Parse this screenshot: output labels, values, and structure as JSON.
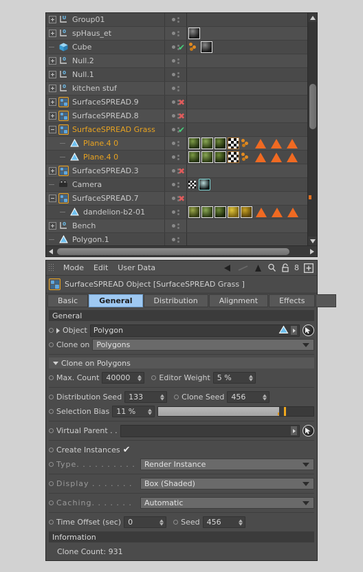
{
  "object_manager": {
    "rows": [
      {
        "name": "Group01",
        "icon": "null-u-icon",
        "indent": 0,
        "expander": "plus",
        "selected": false,
        "mark": "",
        "tags": []
      },
      {
        "name": "spHaus_et",
        "icon": "null-0-icon",
        "indent": 0,
        "expander": "plus",
        "selected": false,
        "mark": "",
        "tags": [
          "material-dark"
        ]
      },
      {
        "name": "Cube",
        "icon": "cube-icon",
        "indent": 0,
        "expander": "stub",
        "selected": false,
        "mark": "ok",
        "tags": [
          "scatter-dots",
          "material-dark"
        ]
      },
      {
        "name": "Null.2",
        "icon": "null-0-icon",
        "indent": 0,
        "expander": "plus",
        "selected": false,
        "mark": "",
        "tags": []
      },
      {
        "name": "Null.1",
        "icon": "null-0-icon",
        "indent": 0,
        "expander": "plus",
        "selected": false,
        "mark": "",
        "tags": []
      },
      {
        "name": "kitchen stuf",
        "icon": "null-0-icon",
        "indent": 0,
        "expander": "plus",
        "selected": false,
        "mark": "",
        "tags": []
      },
      {
        "name": "SurfaceSPREAD.9",
        "icon": "surfacespread-icon",
        "indent": 0,
        "expander": "plus",
        "selected": false,
        "mark": "no",
        "tags": []
      },
      {
        "name": "SurfaceSPREAD.8",
        "icon": "surfacespread-icon",
        "indent": 0,
        "expander": "plus",
        "selected": false,
        "mark": "no",
        "tags": []
      },
      {
        "name": "SurfaceSPREAD Grass",
        "icon": "surfacespread-icon",
        "indent": 0,
        "expander": "minus",
        "selected": true,
        "mark": "ok",
        "tags": []
      },
      {
        "name": "Plane.4 0",
        "icon": "polygon-icon",
        "indent": 1,
        "expander": "stub",
        "selected": true,
        "mark": "",
        "tags": [
          "mat-green-1",
          "mat-green-2",
          "mat-green-3",
          "checker",
          "scatter-dots",
          "tri",
          "tri",
          "tri"
        ]
      },
      {
        "name": "Plane.4 0",
        "icon": "polygon-icon",
        "indent": 1,
        "expander": "stub",
        "selected": true,
        "mark": "",
        "tags": [
          "mat-green-1",
          "mat-green-2",
          "mat-green-3",
          "checker",
          "scatter-dots",
          "tri",
          "tri",
          "tri"
        ]
      },
      {
        "name": "SurfaceSPREAD.3",
        "icon": "surfacespread-icon",
        "indent": 0,
        "expander": "plus",
        "selected": false,
        "mark": "no",
        "tags": []
      },
      {
        "name": "Camera",
        "icon": "camera-icon",
        "indent": 0,
        "expander": "stub",
        "selected": false,
        "mark": "",
        "tags": [
          "checker-small",
          "camera-tag"
        ]
      },
      {
        "name": "SurfaceSPREAD.7",
        "icon": "surfacespread-icon",
        "indent": 0,
        "expander": "minus",
        "selected": false,
        "mark": "no",
        "tags": []
      },
      {
        "name": "dandelion-b2-01",
        "icon": "polygon-icon",
        "indent": 1,
        "expander": "stub",
        "selected": false,
        "mark": "",
        "tags": [
          "mat-olive",
          "mat-green-2",
          "mat-green-3",
          "mat-yellow",
          "mat-yellow-2",
          "tri",
          "tri",
          "tri"
        ]
      },
      {
        "name": "Bench",
        "icon": "null-0-icon",
        "indent": 0,
        "expander": "plus",
        "selected": false,
        "mark": "",
        "tags": []
      },
      {
        "name": "Polygon.1",
        "icon": "polygon-icon",
        "indent": 0,
        "expander": "stub",
        "selected": false,
        "mark": "",
        "tags": []
      }
    ]
  },
  "attribute_manager": {
    "menus": [
      "Mode",
      "Edit",
      "User Data"
    ],
    "toolbar_icons": [
      "back-arrow-icon",
      "history-line-icon",
      "up-arrow-icon",
      "search-icon",
      "lock-icon",
      "group-count-icon",
      "add-panel-icon"
    ],
    "group_count_label": "8",
    "object_title": "SurfaceSPREAD Object [SurfaceSPREAD Grass ]",
    "object_icon": "surfacespread-icon",
    "tabs": [
      {
        "label": "Basic",
        "active": false
      },
      {
        "label": "General",
        "active": true
      },
      {
        "label": "Distribution",
        "active": false
      },
      {
        "label": "Alignment",
        "active": false
      },
      {
        "label": "Effects",
        "active": false
      }
    ],
    "general_group_title": "General",
    "object_field": {
      "label": "Object",
      "value": "Polygon",
      "icon": "polygon-icon",
      "picker": "pick-cursor-icon"
    },
    "clone_on": {
      "label": "Clone on",
      "value": "Polygons"
    },
    "clone_on_polygons": {
      "title": "Clone on Polygons",
      "max_count": {
        "label": "Max. Count",
        "value": "40000"
      },
      "editor_weight": {
        "label": "Editor Weight",
        "value": "5 %"
      },
      "distribution_seed": {
        "label": "Distribution Seed",
        "value": "133"
      },
      "clone_seed": {
        "label": "Clone Seed",
        "value": "456"
      },
      "selection_bias": {
        "label": "Selection Bias",
        "value": "11 %",
        "percent": 11
      }
    },
    "virtual_parent": {
      "label": "Virtual Parent . .",
      "value": ""
    },
    "create_instances": {
      "label": "Create Instances",
      "checked": true,
      "check_glyph": "✔"
    },
    "type": {
      "label": "Type. . . . . . . . . .",
      "value": "Render Instance"
    },
    "display": {
      "label": "Display . . . . . . .",
      "value": "Box (Shaded)"
    },
    "caching": {
      "label": "Caching. . . . . . .",
      "value": "Automatic"
    },
    "time_offset": {
      "label": "Time Offset (sec)",
      "value": "0"
    },
    "seed": {
      "label": "Seed",
      "value": "456"
    },
    "information": {
      "title": "Information",
      "clone_count": "Clone Count: 931"
    }
  },
  "colors": {
    "panel_bg": "#4b4b4b",
    "page_bg": "#d2d2d2",
    "selection_orange": "#e8a321",
    "tab_active_blue": "#9fc9f2",
    "check_green": "#46d07a",
    "cross_red": "#e05c5c",
    "slider_orange": "#f0a81e"
  }
}
